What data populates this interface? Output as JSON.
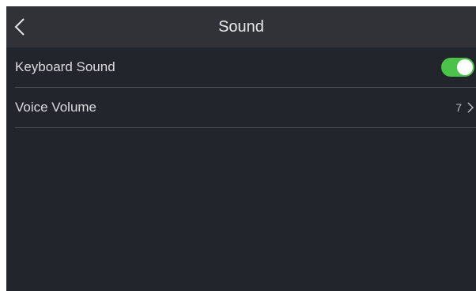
{
  "header": {
    "title": "Sound",
    "back_icon": "chevron-left-icon"
  },
  "settings": {
    "keyboard_sound": {
      "label": "Keyboard Sound",
      "enabled": true,
      "toggle_color": "#4cc24a"
    },
    "voice_volume": {
      "label": "Voice Volume",
      "value": "7",
      "icon": "chevron-right-icon"
    }
  }
}
